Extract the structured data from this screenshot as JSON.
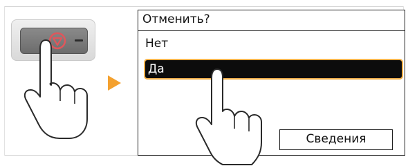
{
  "screen": {
    "title": "Отменить?",
    "options": [
      {
        "label": "Нет",
        "selected": false
      },
      {
        "label": "Да",
        "selected": true
      }
    ],
    "details_button_label": "Сведения"
  },
  "device": {
    "key_icon": "stop-icon",
    "key_symbol": "minus"
  },
  "colors": {
    "selection_background": "#0c0c0c",
    "selection_border": "#f4b24b",
    "arrow": "#f4a12f",
    "stop_icon": "#e0565b"
  }
}
